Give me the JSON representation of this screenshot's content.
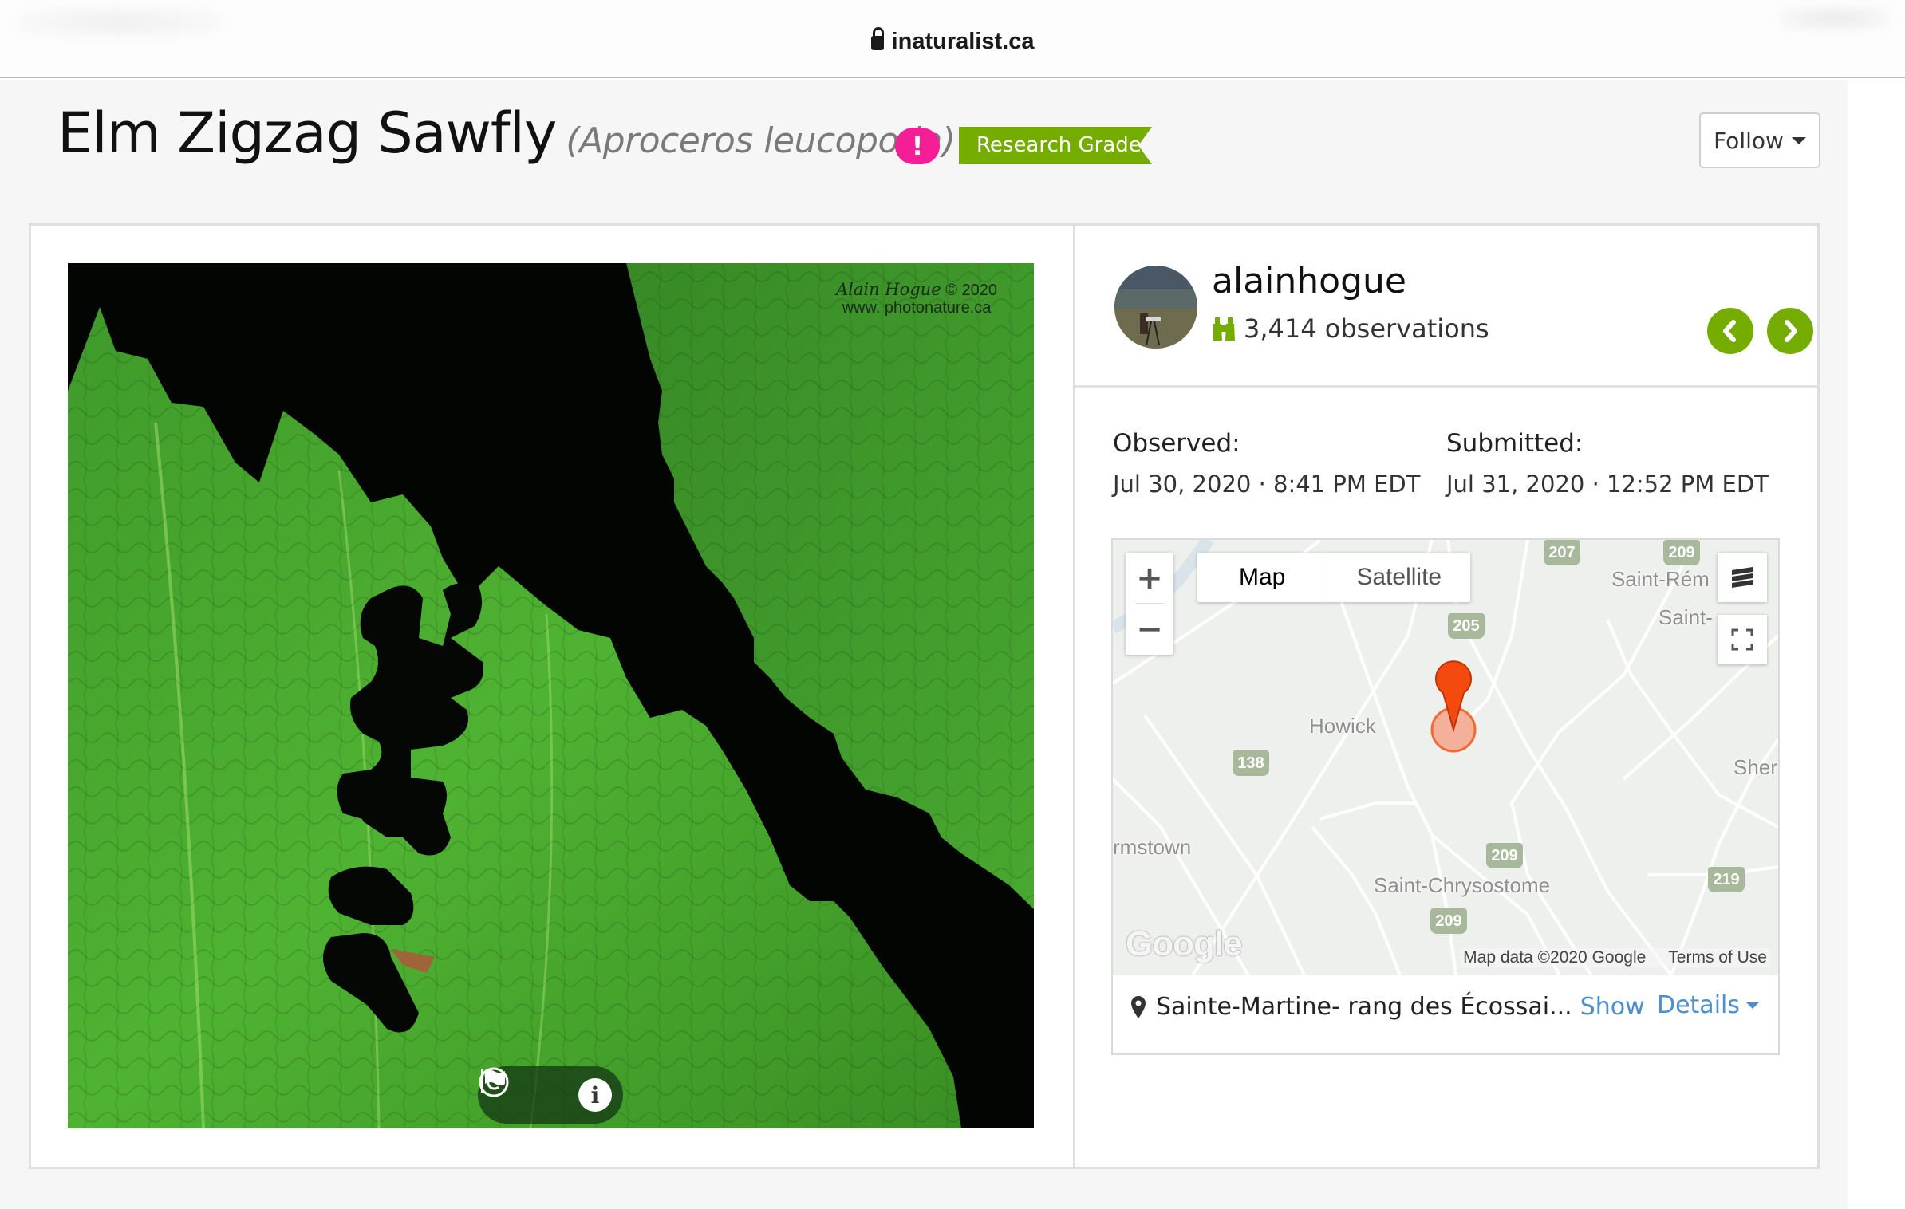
{
  "browser": {
    "url": "inaturalist.ca",
    "lock_icon": "lock-icon"
  },
  "header": {
    "common_name": "Elm Zigzag Sawfly",
    "scientific_name": "(Aproceros leucopoda)",
    "alert_badge": "!",
    "quality_badge": "Research Grade",
    "follow_label": "Follow",
    "colors": {
      "alert": "#f41f96",
      "research_grade": "#74ac00"
    }
  },
  "photo": {
    "credit_author": "Alain Hogue",
    "credit_year": "© 2020",
    "credit_site": "www. photonature.ca",
    "controls": [
      "copyright-icon",
      "flag-icon",
      "info-icon"
    ]
  },
  "observer": {
    "username": "alainhogue",
    "observations": "3,414 observations",
    "prev_icon": "chevron-left-icon",
    "next_icon": "chevron-right-icon"
  },
  "dates": {
    "observed_label": "Observed:",
    "observed_value": "Jul 30, 2020 · 8:41 PM EDT",
    "submitted_label": "Submitted:",
    "submitted_value": "Jul 31, 2020 · 12:52 PM EDT"
  },
  "map": {
    "zoom_in": "+",
    "zoom_out": "−",
    "type_options": [
      "Map",
      "Satellite"
    ],
    "active_type": "Map",
    "places": [
      "Saint-Rém",
      "Saint-Michel",
      "Howick",
      "Sher",
      "rmstown",
      "Saint-Chrysostome",
      "Sainte-Martine"
    ],
    "routes": [
      "207",
      "209",
      "205",
      "138",
      "209",
      "219",
      "209"
    ],
    "google": "Google",
    "attribution": "Map data ©2020 Google",
    "terms": "Terms of Use",
    "marker_color": "#f04a12"
  },
  "location": {
    "name": "Sainte-Martine- rang des Écossai...",
    "show_label": "Show",
    "details_label": "Details"
  }
}
